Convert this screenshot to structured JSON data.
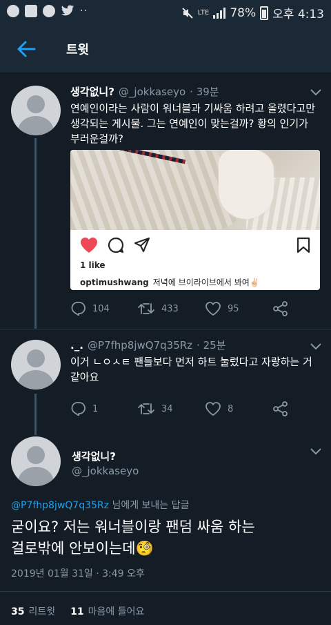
{
  "status_bar": {
    "battery": "78%",
    "network": "LTE",
    "time": "오후 4:13",
    "dots": "··"
  },
  "header": {
    "title": "트윗"
  },
  "tweet1": {
    "name": "생각없니?",
    "handle": "@_jokkaseyo",
    "time": "· 39분",
    "text_line1": "연예인이라는 사람이 워너블과 기싸움 하려고 올렸다고만",
    "text_line2": "생각되는 게시물. 그는 연예인이 맞는걸까? 황의 인기가",
    "text_line3": "부러운걸까?",
    "embed": {
      "likes": "1 like",
      "user": "optimushwang",
      "caption": "저녁에 브이라이브에서 봐여✌🏻"
    },
    "replies": "104",
    "retweets": "433",
    "likes": "95"
  },
  "tweet2": {
    "name": "._.",
    "handle": "@P7fhp8jwQ7q35Rz",
    "time": "· 25분",
    "text_line1": "이거 ㄴㅇㅅㅌ 팬들보다 먼저 하트 눌렀다고 자랑하는 거",
    "text_line2": "같아요",
    "replies": "1",
    "retweets": "34",
    "likes": "8"
  },
  "main_tweet": {
    "name": "생각없니?",
    "handle": "@_jokkaseyo",
    "reply_to_handle": "@P7fhp8jwQ7q35Rz",
    "reply_to_suffix": " 님에게 보내는 답글",
    "text_line1": "굳이요? 저는 워너블이랑 팬덤 싸움 하는",
    "text_line2": "걸로밖에 안보이는데🧐",
    "date": "2019년 01월 31일 · 3:49 오후",
    "retweet_count": "35",
    "retweet_label": "리트윗",
    "like_count": "11",
    "like_label": "마음에 들어요"
  },
  "colors": {
    "background": "#141d26",
    "accent": "#1da1f2",
    "muted": "#8899a6",
    "heart": "#ed4956"
  }
}
